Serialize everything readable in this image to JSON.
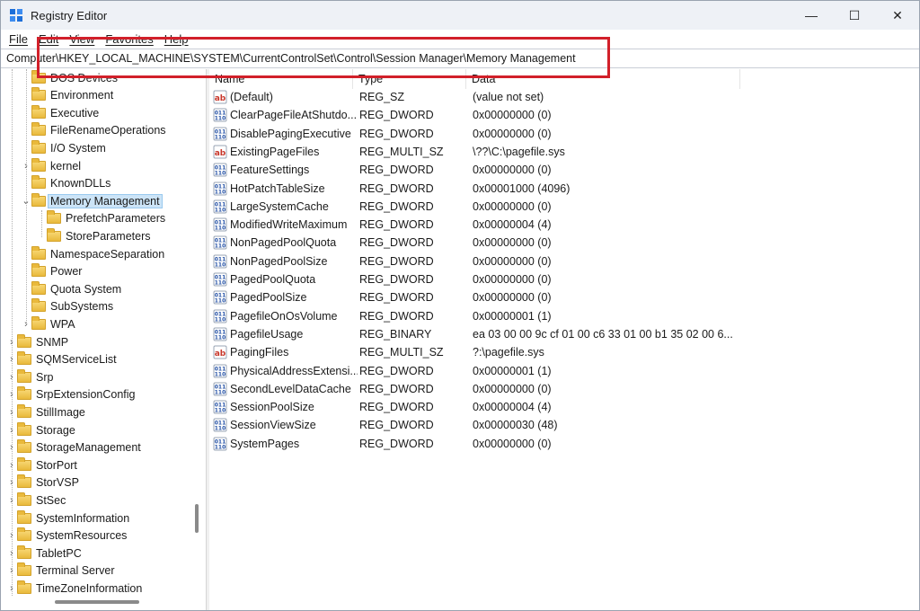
{
  "window": {
    "title": "Registry Editor"
  },
  "titlebar_controls": {
    "minimize": "—",
    "maximize": "☐",
    "close": "✕"
  },
  "menu": {
    "items": [
      {
        "label": "File"
      },
      {
        "label": "Edit"
      },
      {
        "label": "View"
      },
      {
        "label": "Favorites"
      },
      {
        "label": "Help"
      }
    ]
  },
  "address": {
    "path": "Computer\\HKEY_LOCAL_MACHINE\\SYSTEM\\CurrentControlSet\\Control\\Session Manager\\Memory Management"
  },
  "accent": {
    "highlight": "#d2202a",
    "selection": "#cce4f7"
  },
  "tree": {
    "items": [
      {
        "label": "DOS Devices",
        "level": 1,
        "expander": ""
      },
      {
        "label": "Environment",
        "level": 1,
        "expander": ""
      },
      {
        "label": "Executive",
        "level": 1,
        "expander": ""
      },
      {
        "label": "FileRenameOperations",
        "level": 1,
        "expander": ""
      },
      {
        "label": "I/O System",
        "level": 1,
        "expander": ""
      },
      {
        "label": "kernel",
        "level": 1,
        "expander": ">"
      },
      {
        "label": "KnownDLLs",
        "level": 1,
        "expander": ""
      },
      {
        "label": "Memory Management",
        "level": 1,
        "expander": "v",
        "selected": true
      },
      {
        "label": "PrefetchParameters",
        "level": 2,
        "expander": ""
      },
      {
        "label": "StoreParameters",
        "level": 2,
        "expander": ""
      },
      {
        "label": "NamespaceSeparation",
        "level": 1,
        "expander": ""
      },
      {
        "label": "Power",
        "level": 1,
        "expander": ""
      },
      {
        "label": "Quota System",
        "level": 1,
        "expander": ""
      },
      {
        "label": "SubSystems",
        "level": 1,
        "expander": ""
      },
      {
        "label": "WPA",
        "level": 1,
        "expander": ">"
      },
      {
        "label": "SNMP",
        "level": 0,
        "expander": ">"
      },
      {
        "label": "SQMServiceList",
        "level": 0,
        "expander": ">"
      },
      {
        "label": "Srp",
        "level": 0,
        "expander": ">"
      },
      {
        "label": "SrpExtensionConfig",
        "level": 0,
        "expander": ">"
      },
      {
        "label": "StillImage",
        "level": 0,
        "expander": ">"
      },
      {
        "label": "Storage",
        "level": 0,
        "expander": ">"
      },
      {
        "label": "StorageManagement",
        "level": 0,
        "expander": ">"
      },
      {
        "label": "StorPort",
        "level": 0,
        "expander": ">"
      },
      {
        "label": "StorVSP",
        "level": 0,
        "expander": ">"
      },
      {
        "label": "StSec",
        "level": 0,
        "expander": ">"
      },
      {
        "label": "SystemInformation",
        "level": 0,
        "expander": ""
      },
      {
        "label": "SystemResources",
        "level": 0,
        "expander": ">"
      },
      {
        "label": "TabletPC",
        "level": 0,
        "expander": ">"
      },
      {
        "label": "Terminal Server",
        "level": 0,
        "expander": ">"
      },
      {
        "label": "TimeZoneInformation",
        "level": 0,
        "expander": ">"
      }
    ]
  },
  "values": {
    "columns": {
      "name": "Name",
      "type": "Type",
      "data": "Data"
    },
    "rows": [
      {
        "icon": "string-value-icon",
        "name": "(Default)",
        "type": "REG_SZ",
        "data": "(value not set)"
      },
      {
        "icon": "binary-value-icon",
        "name": "ClearPageFileAtShutdo...",
        "type": "REG_DWORD",
        "data": "0x00000000 (0)"
      },
      {
        "icon": "binary-value-icon",
        "name": "DisablePagingExecutive",
        "type": "REG_DWORD",
        "data": "0x00000000 (0)"
      },
      {
        "icon": "string-value-icon",
        "name": "ExistingPageFiles",
        "type": "REG_MULTI_SZ",
        "data": "\\??\\C:\\pagefile.sys"
      },
      {
        "icon": "binary-value-icon",
        "name": "FeatureSettings",
        "type": "REG_DWORD",
        "data": "0x00000000 (0)"
      },
      {
        "icon": "binary-value-icon",
        "name": "HotPatchTableSize",
        "type": "REG_DWORD",
        "data": "0x00001000 (4096)"
      },
      {
        "icon": "binary-value-icon",
        "name": "LargeSystemCache",
        "type": "REG_DWORD",
        "data": "0x00000000 (0)"
      },
      {
        "icon": "binary-value-icon",
        "name": "ModifiedWriteMaximum",
        "type": "REG_DWORD",
        "data": "0x00000004 (4)"
      },
      {
        "icon": "binary-value-icon",
        "name": "NonPagedPoolQuota",
        "type": "REG_DWORD",
        "data": "0x00000000 (0)"
      },
      {
        "icon": "binary-value-icon",
        "name": "NonPagedPoolSize",
        "type": "REG_DWORD",
        "data": "0x00000000 (0)"
      },
      {
        "icon": "binary-value-icon",
        "name": "PagedPoolQuota",
        "type": "REG_DWORD",
        "data": "0x00000000 (0)"
      },
      {
        "icon": "binary-value-icon",
        "name": "PagedPoolSize",
        "type": "REG_DWORD",
        "data": "0x00000000 (0)"
      },
      {
        "icon": "binary-value-icon",
        "name": "PagefileOnOsVolume",
        "type": "REG_DWORD",
        "data": "0x00000001 (1)"
      },
      {
        "icon": "binary-value-icon",
        "name": "PagefileUsage",
        "type": "REG_BINARY",
        "data": "ea 03 00 00 9c cf 01 00 c6 33 01 00 b1 35 02 00 6..."
      },
      {
        "icon": "string-value-icon",
        "name": "PagingFiles",
        "type": "REG_MULTI_SZ",
        "data": "?:\\pagefile.sys"
      },
      {
        "icon": "binary-value-icon",
        "name": "PhysicalAddressExtensi...",
        "type": "REG_DWORD",
        "data": "0x00000001 (1)"
      },
      {
        "icon": "binary-value-icon",
        "name": "SecondLevelDataCache",
        "type": "REG_DWORD",
        "data": "0x00000000 (0)"
      },
      {
        "icon": "binary-value-icon",
        "name": "SessionPoolSize",
        "type": "REG_DWORD",
        "data": "0x00000004 (4)"
      },
      {
        "icon": "binary-value-icon",
        "name": "SessionViewSize",
        "type": "REG_DWORD",
        "data": "0x00000030 (48)"
      },
      {
        "icon": "binary-value-icon",
        "name": "SystemPages",
        "type": "REG_DWORD",
        "data": "0x00000000 (0)"
      }
    ]
  }
}
